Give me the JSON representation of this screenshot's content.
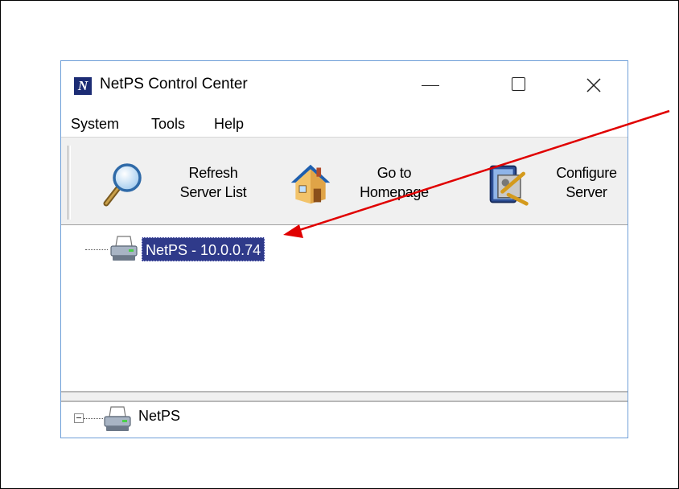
{
  "window": {
    "app_icon_letter": "N",
    "title": "NetPS Control Center"
  },
  "menu": {
    "system": "System",
    "tools": "Tools",
    "help": "Help"
  },
  "toolbar": {
    "refresh": {
      "line1": "Refresh",
      "line2": "Server List",
      "icon": "magnifier-icon"
    },
    "home": {
      "line1": "Go to",
      "line2": "Homepage",
      "icon": "house-icon"
    },
    "config": {
      "line1": "Configure",
      "line2": "Server",
      "icon": "configure-server-icon"
    }
  },
  "tree": {
    "selected_item": "NetPS - 10.0.0.74",
    "item_icon": "printer-icon"
  },
  "bottom_tree": {
    "root_label": "NetPS",
    "expander_state": "expanded"
  },
  "annotation": {
    "arrow_color": "#e00000"
  }
}
